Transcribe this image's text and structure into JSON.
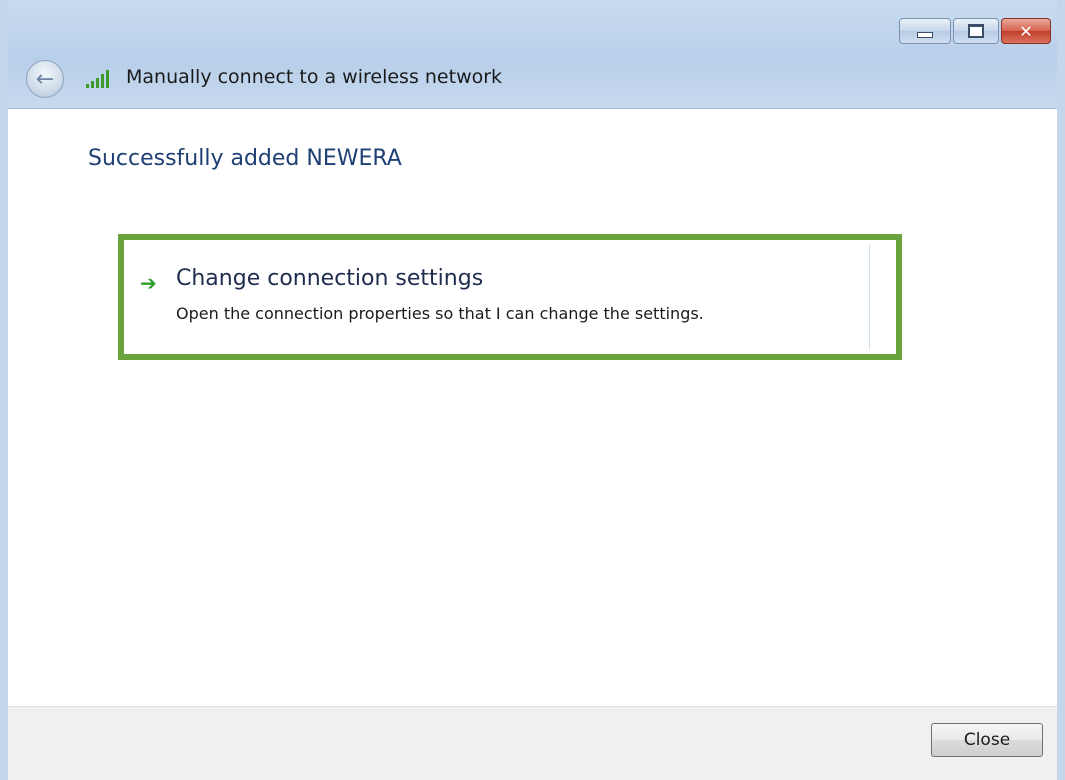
{
  "window": {
    "title": "Manually connect to a wireless network",
    "controls": {
      "minimize_icon": "minimize-icon",
      "maximize_icon": "maximize-icon",
      "close_icon": "close-icon",
      "close_glyph": "✕"
    }
  },
  "main": {
    "heading": "Successfully added NEWERA",
    "option": {
      "icon": "green-arrow-icon",
      "arrow_glyph": "➔",
      "title": "Change connection settings",
      "description": "Open the connection properties so that I can change the settings."
    }
  },
  "footer": {
    "close_label": "Close"
  },
  "colors": {
    "highlight_border": "#6aa33d",
    "heading": "#1e3f73",
    "arrow": "#2f9e2a"
  }
}
